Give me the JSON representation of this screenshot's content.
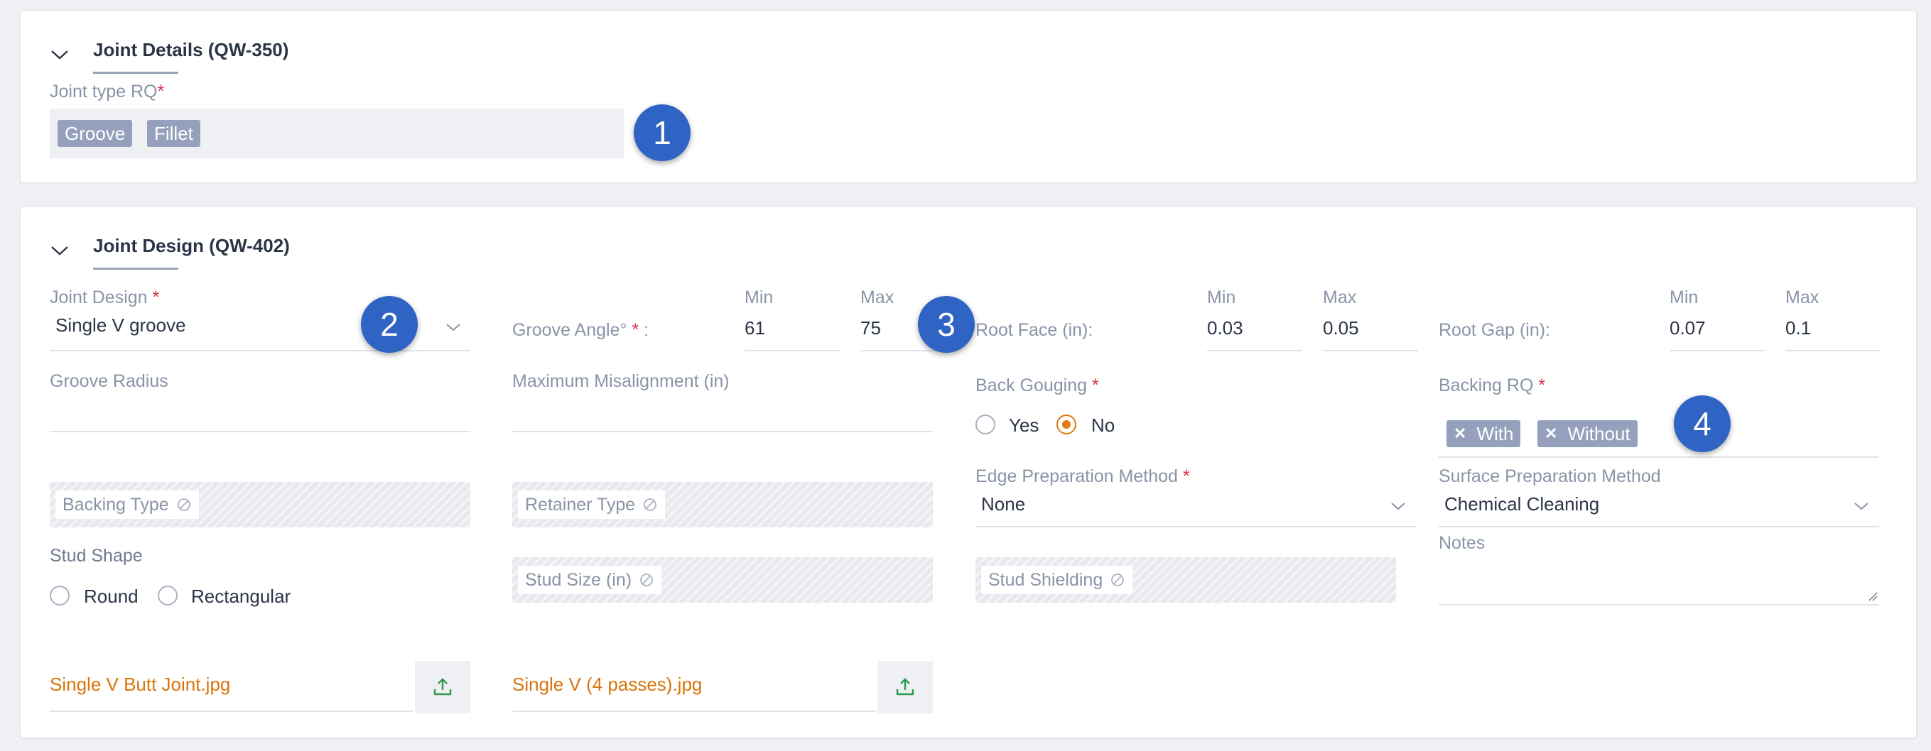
{
  "joint_details": {
    "title": "Joint Details (QW-350)",
    "joint_type_label": "Joint type RQ",
    "required_mark": "*",
    "joint_type_tags": [
      "Groove",
      "Fillet"
    ],
    "callout": "1"
  },
  "joint_design": {
    "title": "Joint Design (QW-402)",
    "joint_design_field": {
      "label": "Joint Design",
      "value": "Single V groove",
      "callout": "2"
    },
    "groove_angle": {
      "label": "Groove Angle° ",
      "suffix": " :",
      "min_label": "Min",
      "max_label": "Max",
      "min": "61",
      "max": "75",
      "callout": "3"
    },
    "root_face": {
      "label": "Root Face (in):",
      "min_label": "Min",
      "max_label": "Max",
      "min": "0.03",
      "max": "0.05"
    },
    "root_gap": {
      "label": "Root Gap (in):",
      "min_label": "Min",
      "max_label": "Max",
      "min": "0.07",
      "max": "0.1"
    },
    "groove_radius": {
      "label": "Groove Radius"
    },
    "max_misalignment": {
      "label": "Maximum Misalignment (in)"
    },
    "back_gouging": {
      "label": "Back Gouging",
      "options": [
        "Yes",
        "No"
      ],
      "selected": "No"
    },
    "backing_rq": {
      "label": "Backing RQ",
      "tags": [
        "With",
        "Without"
      ],
      "callout": "4"
    },
    "backing_type": {
      "label": "Backing Type"
    },
    "retainer_type": {
      "label": "Retainer Type"
    },
    "edge_prep": {
      "label": "Edge Preparation Method",
      "value": "None"
    },
    "surface_prep": {
      "label": "Surface Preparation Method",
      "value": "Chemical Cleaning"
    },
    "stud_shape": {
      "label": "Stud Shape",
      "options": [
        "Round",
        "Rectangular"
      ]
    },
    "stud_size": {
      "label": "Stud Size (in)"
    },
    "stud_shielding": {
      "label": "Stud Shielding"
    },
    "notes": {
      "label": "Notes"
    },
    "files": [
      "Single V Butt Joint.jpg",
      "Single V (4 passes).jpg"
    ]
  },
  "colors": {
    "accent_orange": "#e07a12",
    "callout_blue": "#2f63c4",
    "tag_gray": "#94a0bc",
    "required_red": "#d9314a"
  }
}
